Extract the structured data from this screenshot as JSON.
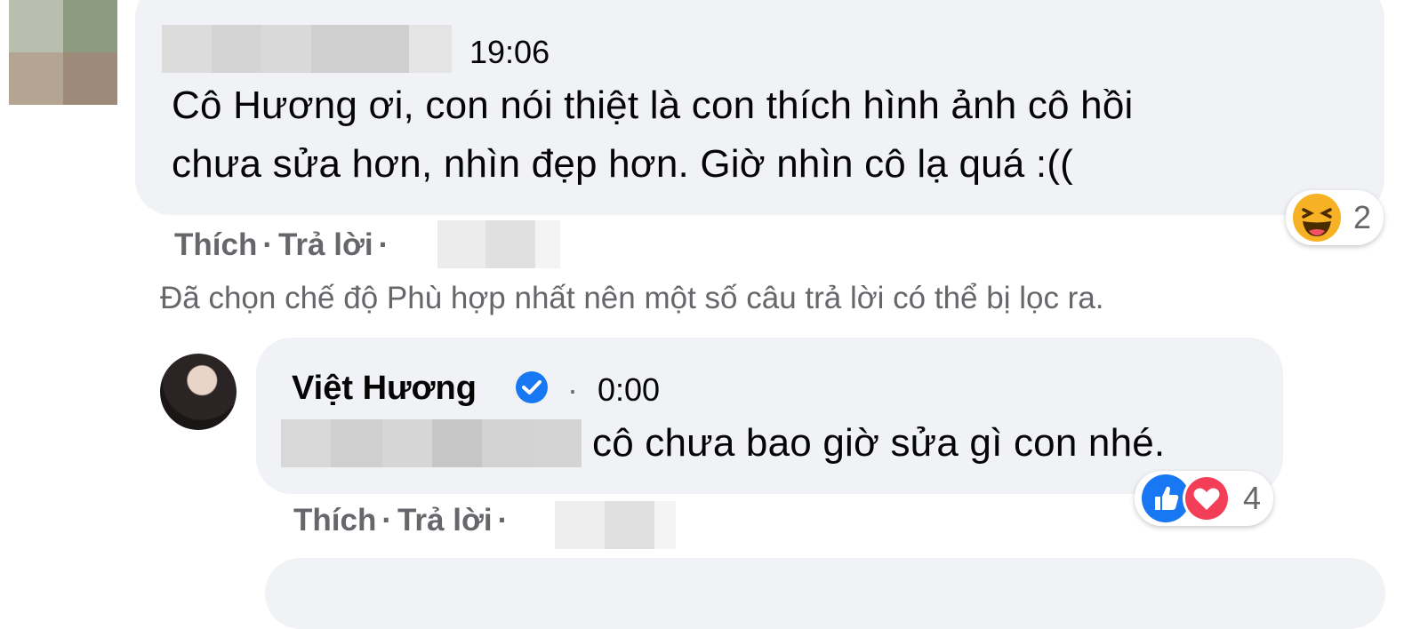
{
  "comment1": {
    "time": "19:06",
    "text_line1": "Cô Hương ơi, con nói thiệt là con thích hình ảnh cô hồi",
    "text_line2": "chưa sửa hơn, nhìn đẹp hơn. Giờ nhìn cô lạ quá :((",
    "reaction_count": "2",
    "reaction_icon": "haha-icon",
    "actions": {
      "like": "Thích",
      "reply": "Trả lời",
      "sep": "·"
    }
  },
  "filter_notice": "Đã chọn chế độ Phù hợp nhất nên một số câu trả lời có thể bị lọc ra.",
  "reply1": {
    "author": "Việt Hương",
    "time": "0:00",
    "text": "cô chưa bao giờ sửa gì con nhé.",
    "reaction_count": "4",
    "reaction_icons": [
      "like-icon",
      "love-icon"
    ],
    "actions": {
      "like": "Thích",
      "reply": "Trả lời",
      "sep": "·"
    }
  },
  "colors": {
    "bubble": "#f0f2f5",
    "secondary_text": "#65676b",
    "like_blue": "#1877f2",
    "love_red": "#f33e58",
    "haha_yellow": "#f7b125"
  }
}
